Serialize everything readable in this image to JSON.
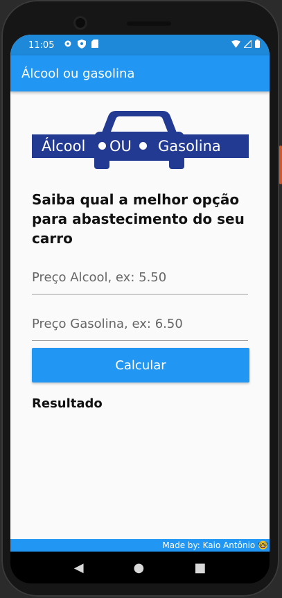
{
  "status": {
    "time": "11:05",
    "left_icons": [
      "settings-icon",
      "shield-icon",
      "sd-card-icon"
    ],
    "right_icons": [
      "wifi-icon",
      "signal-icon",
      "battery-icon"
    ]
  },
  "appbar": {
    "title": "Álcool ou gasolina"
  },
  "logo": {
    "left": "Álcool",
    "middle": "OU",
    "right": "Gasolina"
  },
  "main": {
    "heading": "Saiba qual a melhor opção para abastecimento do seu carro",
    "alcool_placeholder": "Preço Alcool, ex: 5.50",
    "alcool_value": "",
    "gasolina_placeholder": "Preço Gasolina, ex: 6.50",
    "gasolina_value": "",
    "button_label": "Calcular",
    "result_label": "Resultado"
  },
  "footer": {
    "credit": "Made by: Kaio Antônio 🤓"
  },
  "nav": {
    "back": "◀",
    "home": "●",
    "recents": "■"
  },
  "colors": {
    "primary": "#2196f3",
    "status_bar": "#1e88d9",
    "logo_blue": "#233a93"
  }
}
